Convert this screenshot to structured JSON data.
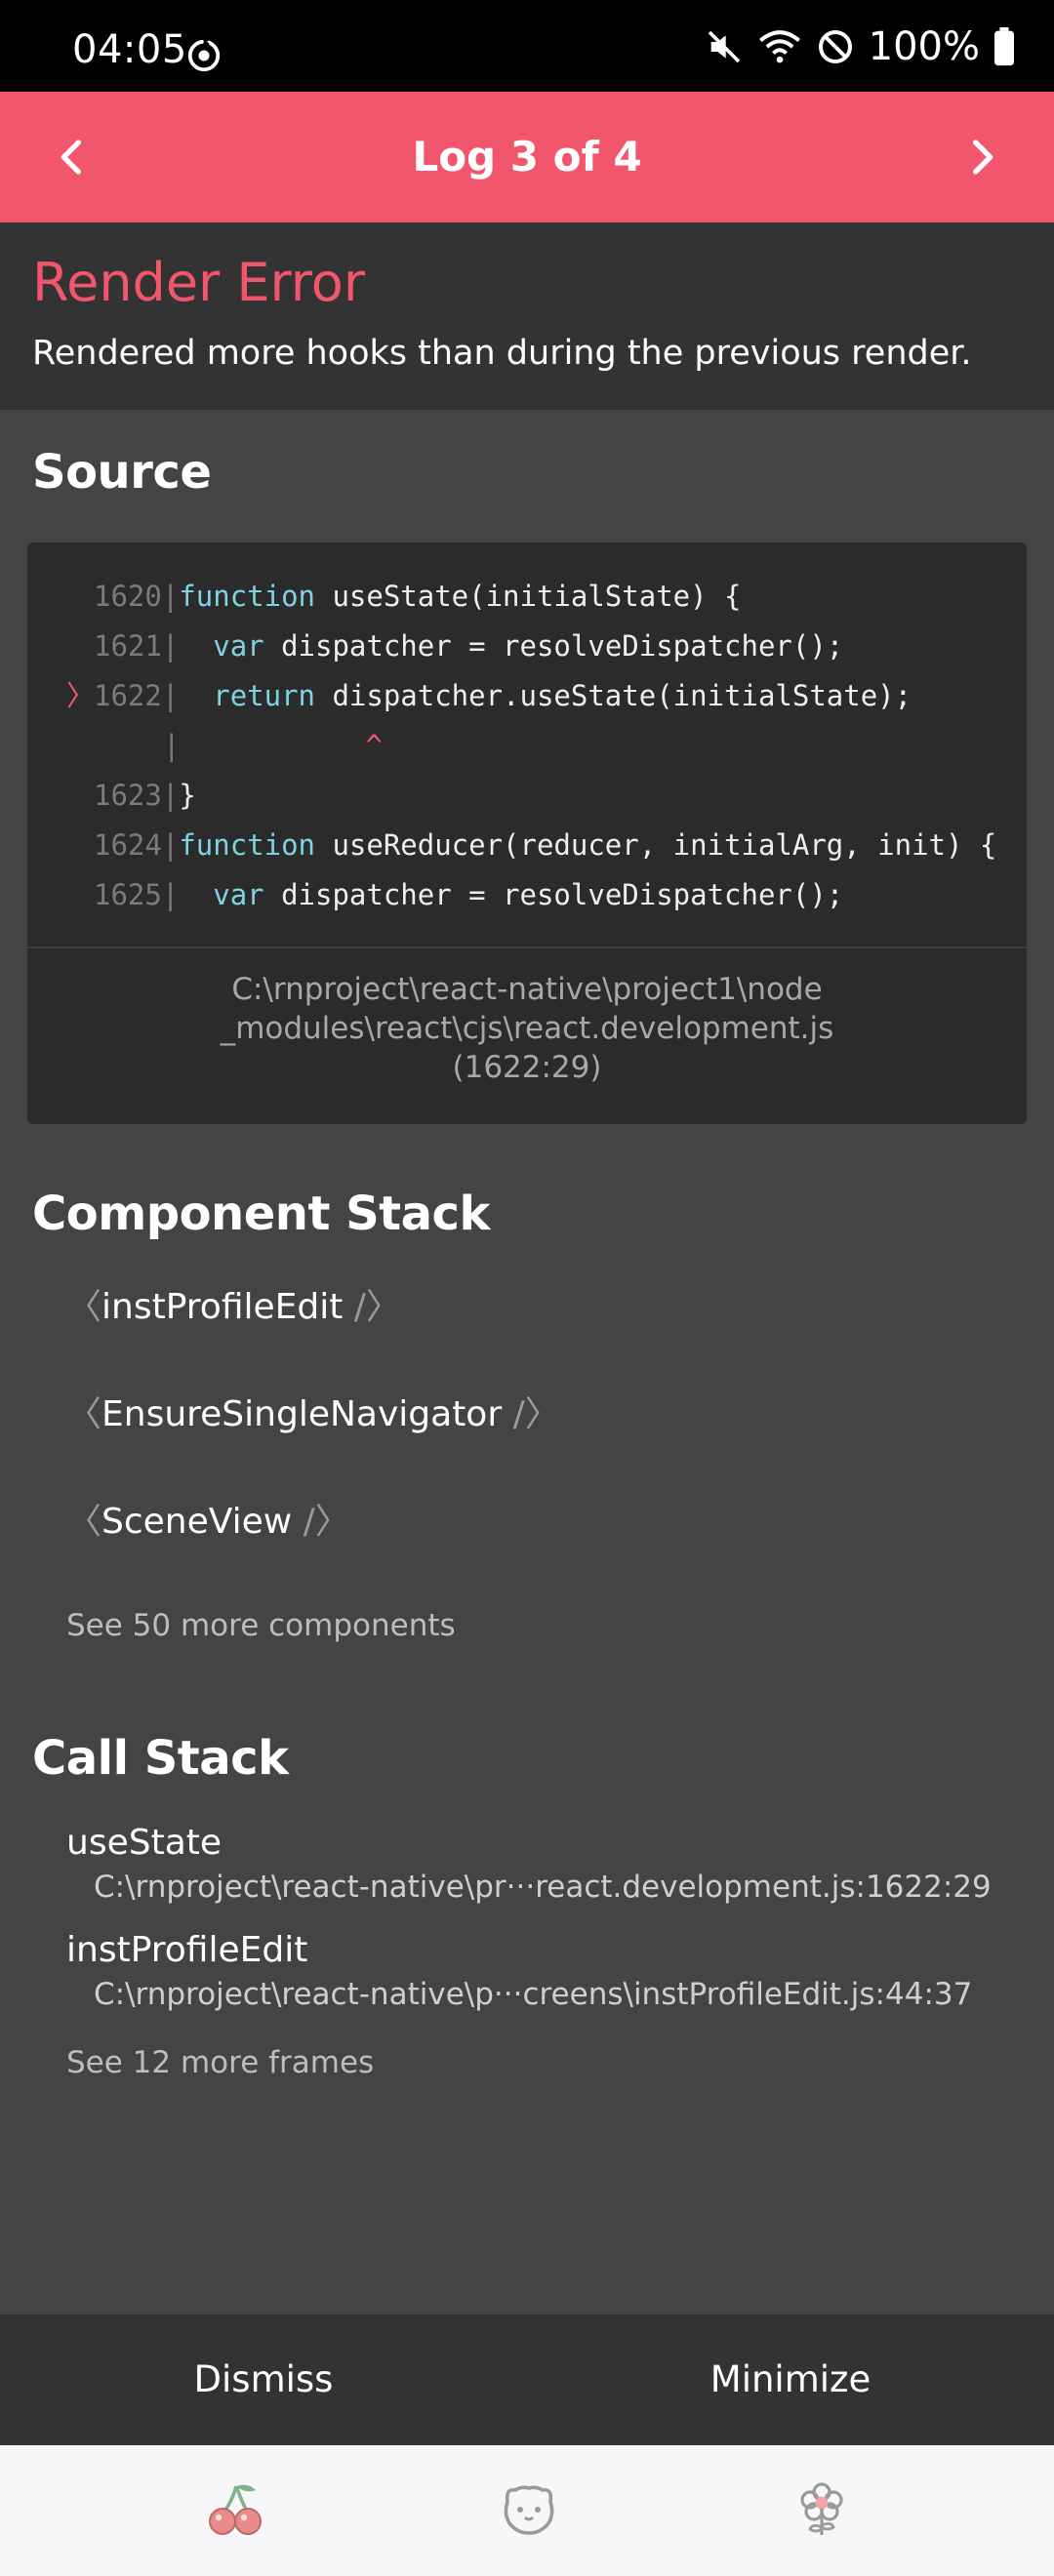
{
  "status": {
    "time": "04:05",
    "battery": "100%",
    "icons": [
      "sync-icon",
      "mute-icon",
      "wifi-icon",
      "dnd-icon",
      "battery-icon"
    ]
  },
  "header": {
    "title": "Log 3 of 4",
    "prev_icon": "chevron-left-icon",
    "next_icon": "chevron-right-icon"
  },
  "error": {
    "title": "Render Error",
    "message": "Rendered more hooks than during the previous render."
  },
  "source": {
    "heading": "Source",
    "lines": [
      {
        "num": "1620",
        "sep": "|",
        "kw": "function",
        "rest": " useState(initialState) {",
        "highlight": false
      },
      {
        "num": "1621",
        "sep": "|",
        "kw": "  var",
        "rest": " dispatcher = resolveDispatcher();",
        "highlight": false
      },
      {
        "num": "1622",
        "sep": "|",
        "kw": "  return",
        "rest": " dispatcher.useState(initialState);",
        "highlight": true
      },
      {
        "num": "",
        "sep": "|",
        "kw": "",
        "rest": "",
        "caret": "^",
        "highlight": false
      },
      {
        "num": "1623",
        "sep": "|",
        "kw": "",
        "rest": "}",
        "highlight": false
      },
      {
        "num": "1624",
        "sep": "|",
        "kw": "function",
        "rest": " useReducer(reducer, initialArg, init) {",
        "highlight": false
      },
      {
        "num": "1625",
        "sep": "|",
        "kw": "  var",
        "rest": " dispatcher = resolveDispatcher();",
        "highlight": false
      }
    ],
    "marker": "〉",
    "file_line1": "C:\\rnproject\\react-native\\project1\\node",
    "file_line2": "_modules\\react\\cjs\\react.development.js",
    "file_line3": "(1622:29)"
  },
  "component_stack": {
    "heading": "Component Stack",
    "items": [
      {
        "open": "〈",
        "name": "instProfileEdit",
        "close": " /〉"
      },
      {
        "open": "〈",
        "name": "EnsureSingleNavigator",
        "close": " /〉"
      },
      {
        "open": "〈",
        "name": "SceneView",
        "close": " /〉"
      }
    ],
    "more": "See 50 more components"
  },
  "call_stack": {
    "heading": "Call Stack",
    "frames": [
      {
        "name": "useState",
        "location": "C:\\rnproject\\react-native\\pr···react.development.js:1622:29"
      },
      {
        "name": "instProfileEdit",
        "location": "C:\\rnproject\\react-native\\p···creens\\instProfileEdit.js:44:37"
      }
    ],
    "more": "See 12 more frames"
  },
  "footer": {
    "dismiss": "Dismiss",
    "minimize": "Minimize"
  },
  "tabbar": {
    "icons": [
      "cherry-icon",
      "bear-face-icon",
      "flower-icon"
    ],
    "colors": {
      "cherry": "#e98b8b",
      "leaf": "#7fb28a",
      "bear": "#9a9a9a",
      "flower": "#f0a5a5"
    }
  },
  "colors": {
    "accent": "#f2566d",
    "background": "#444444",
    "panel": "#333333",
    "code_bg": "#2b2b2b",
    "keyword": "#7fd3e0",
    "operator": "#e6d071"
  }
}
